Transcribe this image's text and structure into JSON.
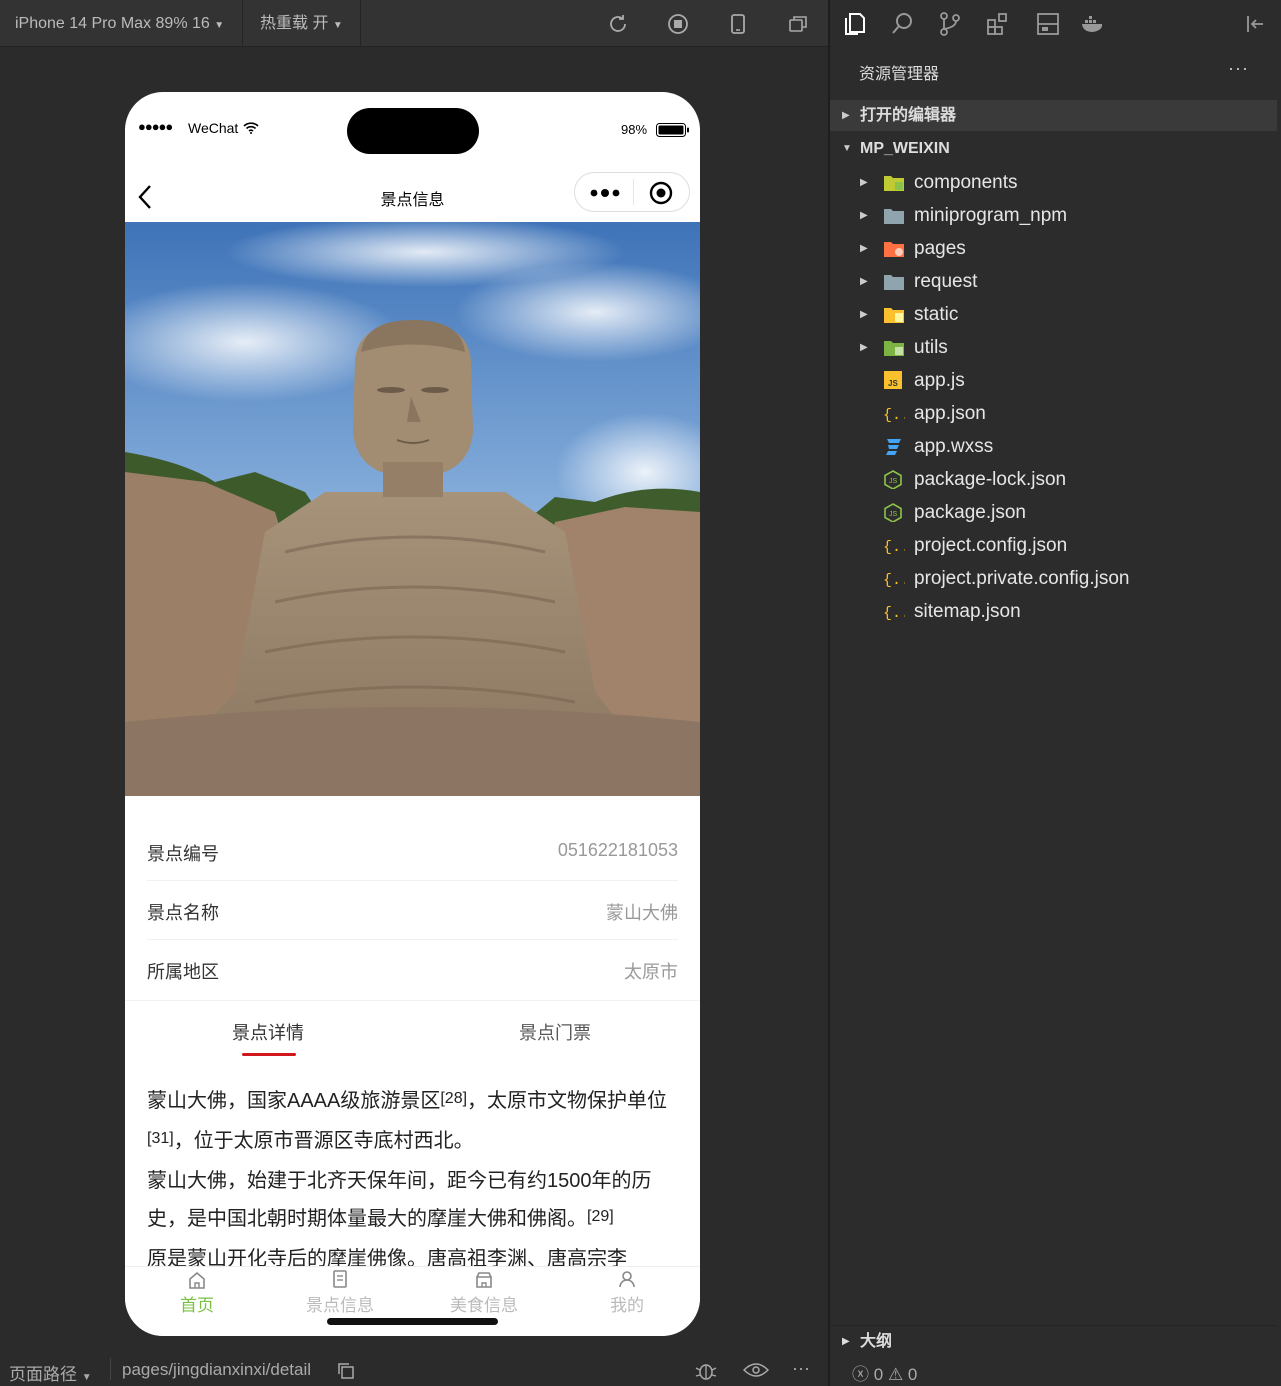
{
  "toolbar": {
    "device": "iPhone 14 Pro Max 89% 16",
    "hot_reload": "热重载 开"
  },
  "phone": {
    "status": {
      "carrier": "WeChat",
      "battery": "98%"
    },
    "nav_title": "景点信息",
    "info": [
      {
        "label": "景点编号",
        "value": "051622181053"
      },
      {
        "label": "景点名称",
        "value": "蒙山大佛"
      },
      {
        "label": "所属地区",
        "value": "太原市"
      }
    ],
    "tabs": [
      {
        "label": "景点详情",
        "active": true
      },
      {
        "label": "景点门票",
        "active": false
      }
    ],
    "article": {
      "p1_a": "蒙山大佛，国家AAAA级旅游景区",
      "p1_ref1": "[28]",
      "p1_b": "，太原市文物保护单位",
      "p1_ref2": "[31]",
      "p1_c": "，位于太原市晋源区寺底村西北。",
      "p2_a": "蒙山大佛，始建于北齐天保年间，距今已有约1500年的历史，是中国北朝时期体量最大的摩崖大佛和佛阁。",
      "p2_ref": "[29]",
      "p3": "原是蒙山开化寺后的摩崖佛像。唐高祖李渊、唐高宗李"
    },
    "tabbar": [
      {
        "label": "首页",
        "icon": "home-icon",
        "active": true
      },
      {
        "label": "景点信息",
        "icon": "document-icon",
        "active": false
      },
      {
        "label": "美食信息",
        "icon": "store-icon",
        "active": false
      },
      {
        "label": "我的",
        "icon": "user-icon",
        "active": false
      }
    ],
    "accent": "#7ac143",
    "tab_underline": "#d0171c"
  },
  "statusbar": {
    "path_label": "页面路径",
    "path": "pages/jingdianxinxi/detail"
  },
  "explorer": {
    "title": "资源管理器",
    "more": "···",
    "open_editors": "打开的编辑器",
    "project": "MP_WEIXIN",
    "folders": [
      {
        "name": "components",
        "icon": "components-folder-icon"
      },
      {
        "name": "miniprogram_npm",
        "icon": "folder-icon"
      },
      {
        "name": "pages",
        "icon": "pages-folder-icon"
      },
      {
        "name": "request",
        "icon": "folder-icon"
      },
      {
        "name": "static",
        "icon": "static-folder-icon"
      },
      {
        "name": "utils",
        "icon": "utils-folder-icon"
      }
    ],
    "files": [
      {
        "name": "app.js",
        "icon": "js-file-icon"
      },
      {
        "name": "app.json",
        "icon": "json-file-icon"
      },
      {
        "name": "app.wxss",
        "icon": "css-file-icon"
      },
      {
        "name": "package-lock.json",
        "icon": "nodejs-file-icon"
      },
      {
        "name": "package.json",
        "icon": "nodejs-file-icon"
      },
      {
        "name": "project.config.json",
        "icon": "json-file-icon"
      },
      {
        "name": "project.private.config.json",
        "icon": "json-file-icon"
      },
      {
        "name": "sitemap.json",
        "icon": "json-file-icon"
      }
    ],
    "outline": "大纲",
    "errors": "0",
    "warnings": "0"
  }
}
